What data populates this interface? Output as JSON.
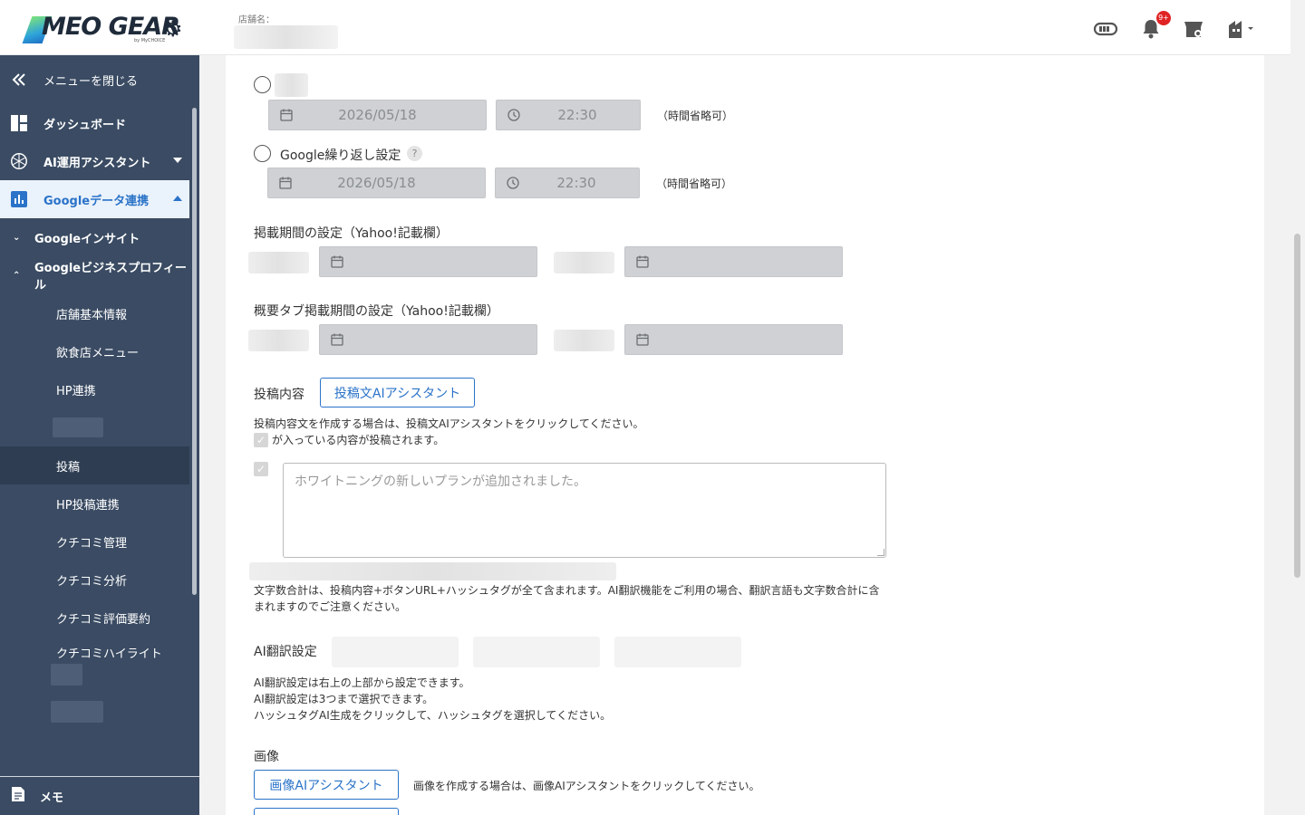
{
  "header": {
    "logo_text": "MEO GEAR",
    "logo_sub": "by MyCHOICE",
    "store_label": "店舗名："
  },
  "notifications": {
    "badge": "9+"
  },
  "sidebar": {
    "close_menu": "メニューを閉じる",
    "items": [
      {
        "label": "ダッシュボード"
      },
      {
        "label": "AI運用アシスタント"
      },
      {
        "label": "Googleデータ連携"
      },
      {
        "label": "Googleインサイト"
      },
      {
        "label": "Googleビジネスプロフィール"
      },
      {
        "label": "店舗基本情報"
      },
      {
        "label": "飲食店メニュー"
      },
      {
        "label": "HP連携"
      },
      {
        "label": "投稿"
      },
      {
        "label": "HP投稿連携"
      },
      {
        "label": "クチコミ管理"
      },
      {
        "label": "クチコミ分析"
      },
      {
        "label": "クチコミ評価要約"
      },
      {
        "label": "クチコミハイライト"
      }
    ],
    "memo": "メモ"
  },
  "form": {
    "schedule1": {
      "date": "2026/05/18",
      "time": "22:30",
      "note": "（時間省略可）"
    },
    "repeat": {
      "label": "Google繰り返し設定",
      "help": "?",
      "date": "2026/05/18",
      "time": "22:30",
      "note": "（時間省略可）"
    },
    "yahoo_period_label": "掲載期間の設定（Yahoo!記載欄）",
    "yahoo_overview_label": "概要タブ掲載期間の設定（Yahoo!記載欄）",
    "post_content_label": "投稿内容",
    "post_ai_button": "投稿文AIアシスタント",
    "post_hint": "投稿内容文を作成する場合は、投稿文AIアシスタントをクリックしてください。",
    "check_hint": "が入っている内容が投稿されます。",
    "textarea_value": "ホワイトニングの新しいプランが追加されました。",
    "char_count_note": "文字数合計は、投稿内容+ボタンURL+ハッシュタグが全て含まれます。AI翻訳機能をご利用の場合、翻訳言語も文字数合計に含まれますのでご注意ください。",
    "translation_label": "AI翻訳設定",
    "translation_notes": [
      "AI翻訳設定は右上の上部から設定できます。",
      "AI翻訳設定は3つまで選択できます。",
      "ハッシュタグAI生成をクリックして、ハッシュタグを選択してください。"
    ],
    "image_label": "画像",
    "image_ai_button": "画像AIアシスタント",
    "image_hint": "画像を作成する場合は、画像AIアシスタントをクリックしてください。"
  }
}
